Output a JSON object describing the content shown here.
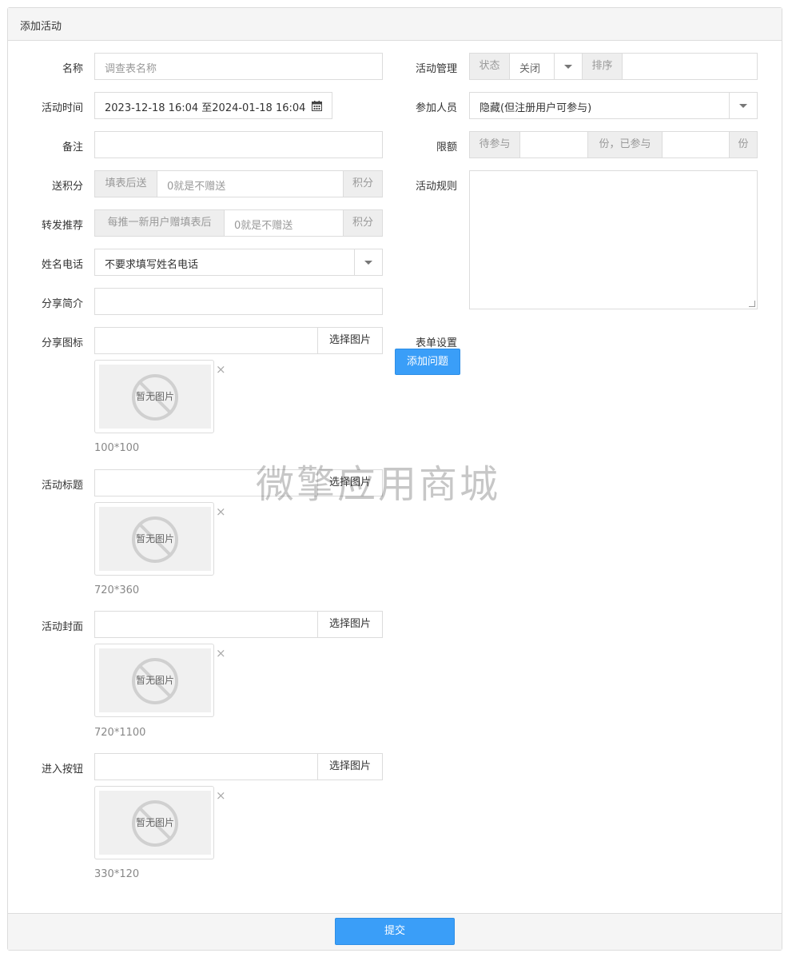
{
  "panel": {
    "title": "添加活动",
    "submit_label": "提交"
  },
  "watermark": "微擎应用商城",
  "left": {
    "name": {
      "label": "名称",
      "placeholder": "调查表名称",
      "value": ""
    },
    "time": {
      "label": "活动时间",
      "value": "2023-12-18 16:04 至2024-01-18 16:04",
      "icon": "calendar-icon"
    },
    "remark": {
      "label": "备注",
      "value": ""
    },
    "points": {
      "label": "送积分",
      "prefix": "填表后送",
      "placeholder": "0就是不赠送",
      "suffix": "积分"
    },
    "referral": {
      "label": "转发推荐",
      "prefix": "每推一新用户赠填表后",
      "placeholder": "0就是不赠送",
      "suffix": "积分"
    },
    "contact": {
      "label": "姓名电话",
      "value": "不要求填写姓名电话"
    },
    "share_intro": {
      "label": "分享简介",
      "value": ""
    },
    "share_icon": {
      "label": "分享图标",
      "button": "选择图片",
      "no_image": "暂无图片",
      "size": "100*100"
    },
    "title_img": {
      "label": "活动标题",
      "button": "选择图片",
      "no_image": "暂无图片",
      "size": "720*360"
    },
    "cover": {
      "label": "活动封面",
      "button": "选择图片",
      "no_image": "暂无图片",
      "size": "720*1100"
    },
    "enter_btn": {
      "label": "进入按钮",
      "button": "选择图片",
      "no_image": "暂无图片",
      "size": "330*120"
    }
  },
  "right": {
    "manage": {
      "label": "活动管理",
      "status_label": "状态",
      "status_value": "关闭",
      "sort_label": "排序",
      "sort_value": ""
    },
    "participants": {
      "label": "参加人员",
      "value": "隐藏(但注册用户可参与)"
    },
    "quota": {
      "label": "限额",
      "waiting_label": "待参与",
      "mid_label": "份，已参与",
      "end_label": "份"
    },
    "rules": {
      "label": "活动规则",
      "value": ""
    },
    "form": {
      "label": "表单设置",
      "add_button": "添加问题"
    }
  }
}
